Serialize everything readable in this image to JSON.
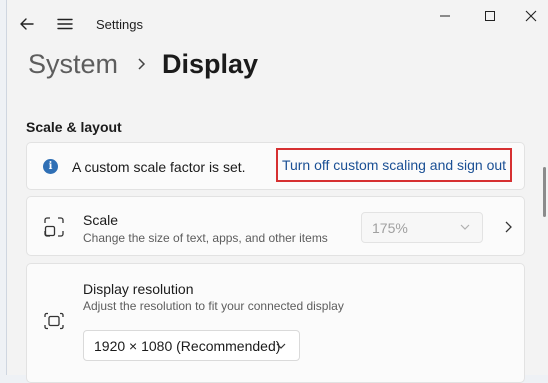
{
  "window": {
    "title": "Settings"
  },
  "breadcrumb": {
    "root": "System",
    "current": "Display"
  },
  "section": {
    "title": "Scale & layout"
  },
  "info": {
    "icon": "info-icon",
    "message": "A custom scale factor is set.",
    "link": "Turn off custom scaling and sign out",
    "highlight_color": "#d63031"
  },
  "scale": {
    "title": "Scale",
    "subtitle": "Change the size of text, apps, and other items",
    "value": "175%",
    "enabled": false
  },
  "resolution": {
    "title": "Display resolution",
    "subtitle": "Adjust the resolution to fit your connected display",
    "value": "1920 × 1080 (Recommended)"
  },
  "colors": {
    "accent": "#2f6fb5",
    "link": "#1a4f94"
  }
}
